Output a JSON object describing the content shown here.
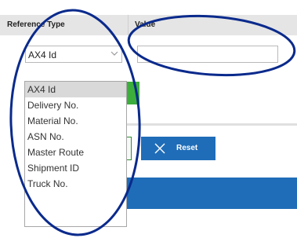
{
  "table": {
    "headers": {
      "reference_type": "Reference Type",
      "value": "Value"
    }
  },
  "reference_select": {
    "selected": "AX4 Id",
    "icon": "chevron-down-icon"
  },
  "value_input": {
    "value": "",
    "placeholder": ""
  },
  "dropdown": {
    "options": [
      "AX4 Id",
      "Delivery No.",
      "Material No.",
      "ASN No.",
      "Master Route",
      "Shipment ID",
      "Truck No."
    ],
    "selected_index": 0
  },
  "actions": {
    "reset_label": "Reset",
    "reset_icon": "close-icon"
  },
  "colors": {
    "header_bg": "#e5e5e5",
    "primary_blue": "#1f6db8",
    "green": "#3cae3c",
    "annotation_ink": "#0a2a8c",
    "selected_option_bg": "#d9d9d9"
  }
}
